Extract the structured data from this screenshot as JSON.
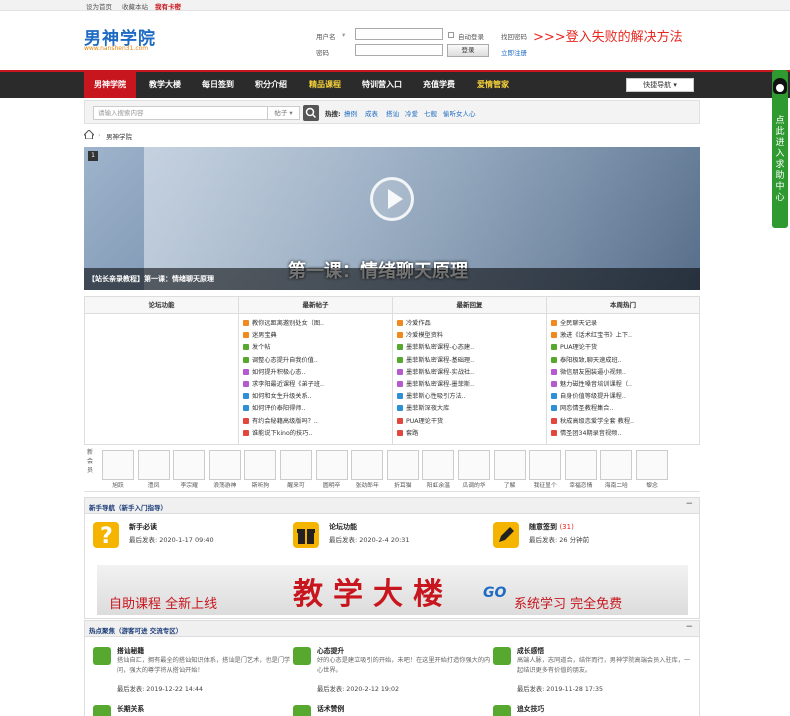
{
  "topbar": {
    "set_home": "设为首页",
    "bookmark": "收藏本站",
    "my_card": "我有卡密"
  },
  "header": {
    "logo_main": "男神学院",
    "logo_sub": "www.nanshen31.com",
    "username_label": "用户名",
    "password_label": "密码",
    "auto_login": "自动登录",
    "find_password": "找回密码",
    "login_button": "登录",
    "register": "立即注册",
    "promo": ">>>登入失败的解决方法"
  },
  "nav": {
    "items": [
      {
        "label": "男神学院"
      },
      {
        "label": "教学大楼"
      },
      {
        "label": "每日签到"
      },
      {
        "label": "积分介绍"
      },
      {
        "label": "精品课程"
      },
      {
        "label": "特训营入口"
      },
      {
        "label": "充值学费"
      },
      {
        "label": "爱情管家"
      }
    ],
    "quick_nav": "快捷导航 ▾"
  },
  "search": {
    "placeholder": "请输入搜索内容",
    "type": "帖子 ▾",
    "hot_label": "热搜:",
    "hot_terms": [
      "撩例",
      "成表",
      "搭讪",
      "冷爱",
      "七舰",
      "偷听女人心"
    ]
  },
  "breadcrumb": {
    "current": "男神学院"
  },
  "banner": {
    "slide_number": "1",
    "caption": "【站长亲录教程】第一课：情绪聊天原理",
    "title": "第一课：情绪聊天原理"
  },
  "stats": {
    "columns": [
      {
        "header": "论坛功能",
        "items": []
      },
      {
        "header": "最新帖子",
        "items": [
          {
            "text": "教你远距离邀别处女（图..",
            "color": "#f08a1c"
          },
          {
            "text": "迷男宝典",
            "color": "#f08a1c"
          },
          {
            "text": "发个帖",
            "color": "#56a82f"
          },
          {
            "text": "调整心态提升自我价值..",
            "color": "#56a82f"
          },
          {
            "text": "如何提升积极心态..",
            "color": "#b45bd0"
          },
          {
            "text": "求李阳最近课程《弟子班..",
            "color": "#b45bd0"
          },
          {
            "text": "如何和女生升级关系..",
            "color": "#2e8fd6"
          },
          {
            "text": "如何评价泰阳得师..",
            "color": "#2e8fd6"
          },
          {
            "text": "有约会秘籍高级版吗？..",
            "color": "#e2463c"
          },
          {
            "text": "谁能说下kino的技巧..",
            "color": "#e2463c"
          }
        ]
      },
      {
        "header": "最新回复",
        "items": [
          {
            "text": "冷爱作品",
            "color": "#f08a1c"
          },
          {
            "text": "冷爱模型资料",
            "color": "#f08a1c"
          },
          {
            "text": "墨菲斯私密课程-心态建..",
            "color": "#56a82f"
          },
          {
            "text": "墨菲斯私密课程-基础理..",
            "color": "#56a82f"
          },
          {
            "text": "墨菲斯私密课程-实战社..",
            "color": "#b45bd0"
          },
          {
            "text": "墨菲斯私密课程-墨菲斯..",
            "color": "#b45bd0"
          },
          {
            "text": "墨菲斯心性吸引方法..",
            "color": "#2e8fd6"
          },
          {
            "text": "墨菲斯深夜大库",
            "color": "#2e8fd6"
          },
          {
            "text": "PUA理论干货",
            "color": "#e2463c"
          },
          {
            "text": "套路",
            "color": "#e2463c"
          }
        ]
      },
      {
        "header": "本周热门",
        "items": [
          {
            "text": "全民聊天记录",
            "color": "#f08a1c"
          },
          {
            "text": "激进《话术红宝书》上下..",
            "color": "#f08a1c"
          },
          {
            "text": "PUA理论干货",
            "color": "#56a82f"
          },
          {
            "text": "泰阳极致,聊天速成班..",
            "color": "#56a82f"
          },
          {
            "text": "微信朋友圈装逼小视频..",
            "color": "#b45bd0"
          },
          {
            "text": "魅力磁性嗓音培训课程（..",
            "color": "#b45bd0"
          },
          {
            "text": "自身价值等级提升课程..",
            "color": "#2e8fd6"
          },
          {
            "text": "网恋情圣教程集合..",
            "color": "#2e8fd6"
          },
          {
            "text": "秋成高级恋爱学全套 教程..",
            "color": "#e2463c"
          },
          {
            "text": "情圣团34期录音视频..",
            "color": "#e2463c"
          }
        ]
      }
    ]
  },
  "members": {
    "label": "新会员",
    "names": [
      "旭跃",
      "澧凤",
      "李宗耀",
      "浪荡游神",
      "斯听狗",
      "醒来可",
      "圆明卒",
      "张劲郎年",
      "折耳猫",
      "阳虹余温",
      "瓜调的华",
      "了解",
      "我征显个",
      "幸福恋情",
      "海南二哈",
      "黎念"
    ]
  },
  "guide_section": {
    "title": "新手导航（新手入门指导）",
    "toggle": "−",
    "forums": [
      {
        "name": "新手必读",
        "last": "最后发表: 2020-1-17 09:40",
        "extra": ""
      },
      {
        "name": "论坛功能",
        "last": "最后发表: 2020-2-4 20:31",
        "extra": ""
      },
      {
        "name": "随意签到",
        "last": "最后发表: 26 分钟前",
        "extra": "(31)"
      }
    ],
    "ad": {
      "left": "自助课程  全新上线",
      "center": "教学大楼",
      "go": "GO",
      "right": "系统学习  完全免费"
    }
  },
  "hot_section": {
    "title": "热点聚焦（游客可进 交流专区）",
    "toggle": "−",
    "forums": [
      {
        "name": "搭讪秘籍",
        "desc": "搭讪自汇，拥有最全的搭讪知识体系，搭讪是门艺术，也是门学问，强大的尊学将从搭讪开始！",
        "last": "最后发表: 2019-12-22 14:44"
      },
      {
        "name": "心态提升",
        "desc": "好的心态是建立吸引的开始，未吧！在这里开始打造你强大的内心世界。",
        "last": "最后发表: 2020-2-12 19:02"
      },
      {
        "name": "成长感悟",
        "desc": "高端人脉，志同道合，结伴而行，男神学院高端会员入驻库，一起结识更多有价值的朋友。",
        "last": "最后发表: 2019-11-28 17:35"
      }
    ],
    "next_row": [
      "长期关系",
      "话术赞例",
      "追女技巧"
    ]
  },
  "qq": {
    "text": "点此进入求助中心"
  }
}
